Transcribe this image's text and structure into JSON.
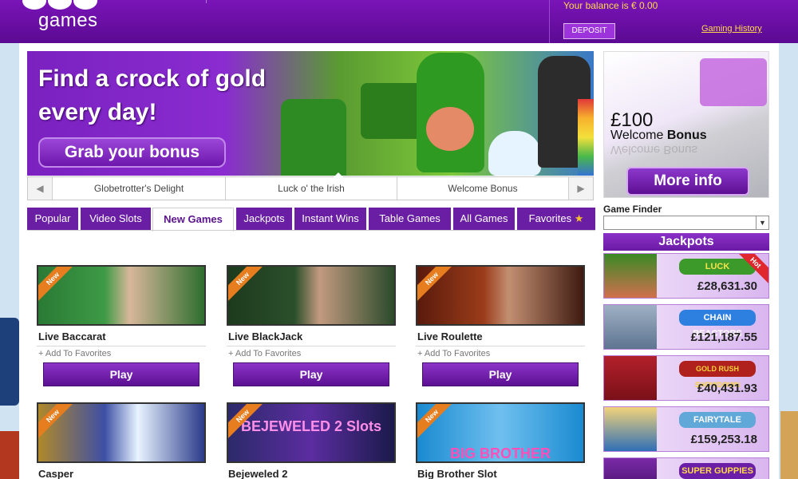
{
  "header": {
    "logo_text": "games",
    "balance_text": "Your balance is € 0.00",
    "deposit_label": "DEPOSIT",
    "history_label": "Gaming History"
  },
  "banner": {
    "title": "Find a crock of gold every day!",
    "button_label": "Grab your bonus"
  },
  "carousel": {
    "prev_icon": "◀",
    "next_icon": "▶",
    "items": [
      "Globetrotter's Delight",
      "Luck o' the Irish",
      "Welcome Bonus"
    ],
    "active_index": 1
  },
  "tabs": [
    {
      "label": "Popular"
    },
    {
      "label": "Video Slots"
    },
    {
      "label": "New Games"
    },
    {
      "label": "Jackpots"
    },
    {
      "label": "Instant Wins"
    },
    {
      "label": "Table Games"
    },
    {
      "label": "All Games"
    },
    {
      "label": "Favorites",
      "icon": "★"
    }
  ],
  "active_tab": "New Games",
  "games": [
    {
      "name": "Live Baccarat",
      "badge": "New",
      "fav": "+ Add To Favorites",
      "play": "Play"
    },
    {
      "name": "Live BlackJack",
      "badge": "New",
      "fav": "+ Add To Favorites",
      "play": "Play"
    },
    {
      "name": "Live Roulette",
      "badge": "New",
      "fav": "+ Add To Favorites",
      "play": "Play"
    },
    {
      "name": "Casper",
      "badge": "New"
    },
    {
      "name": "Bejeweled 2",
      "badge": "New",
      "thumb_text": "BEJEWELED 2 Slots"
    },
    {
      "name": "Big Brother Slot",
      "badge": "New",
      "thumb_text": "BIG BROTHER"
    }
  ],
  "promo": {
    "amount": "£100",
    "text_plain": "Welcome ",
    "text_bold": "Bonus",
    "reflection": "Welcome Bonus",
    "button_label": "More info"
  },
  "finder": {
    "label": "Game Finder",
    "value": "",
    "arrow": "▼"
  },
  "jackpots": {
    "title": "Jackpots",
    "items": [
      {
        "logo": "LUCK",
        "amount": "£28,631.30",
        "badge": "Hot"
      },
      {
        "logo": "CHAIN REACTORS",
        "amount": "£121,187.55"
      },
      {
        "logo": "GOLD RUSH SHOWDOWN",
        "amount": "£40,431.93"
      },
      {
        "logo": "FAIRYTALE",
        "amount": "£159,253.18"
      },
      {
        "logo": "SUPER GUPPIES",
        "amount": ""
      }
    ]
  },
  "colors": {
    "brand_purple": "#6a1ea3",
    "header_purple": "#7a14b8",
    "accent_yellow": "#ffd94a",
    "new_badge": "#e67d1e",
    "hot_badge": "#e0272e"
  }
}
